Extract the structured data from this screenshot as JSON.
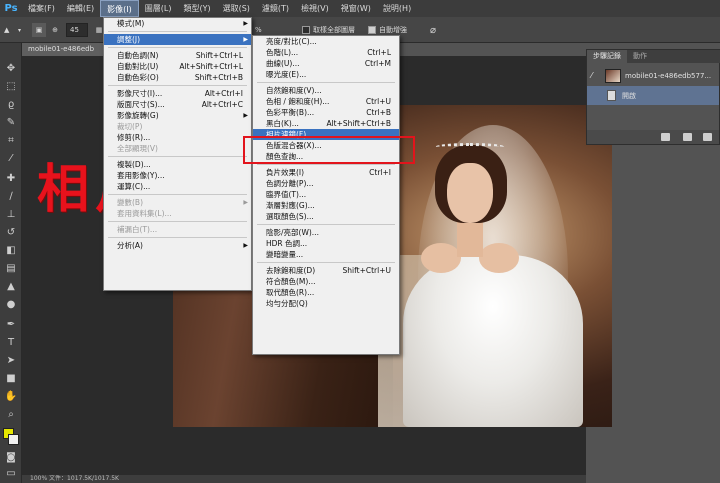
{
  "app": {
    "logo": "Ps"
  },
  "menubar": [
    "檔案(F)",
    "編輯(E)",
    "影像(I)",
    "圖層(L)",
    "類型(Y)",
    "選取(S)",
    "濾鏡(T)",
    "檢視(V)",
    "視窗(W)",
    "說明(H)"
  ],
  "options": {
    "size": "45",
    "percent": "%",
    "sample_all_layers": "取樣全部圖層",
    "auto_enhance": "自動增強"
  },
  "doc_tab": "mobile01-e486edb",
  "image_menu": [
    {
      "label": "模式(M)",
      "arrow": true
    },
    {
      "sep": true
    },
    {
      "label": "調整(J)",
      "arrow": true,
      "hl": true
    },
    {
      "sep": true
    },
    {
      "label": "自動色調(N)",
      "sc": "Shift+Ctrl+L"
    },
    {
      "label": "自動對比(U)",
      "sc": "Alt+Shift+Ctrl+L"
    },
    {
      "label": "自動色彩(O)",
      "sc": "Shift+Ctrl+B"
    },
    {
      "sep": true
    },
    {
      "label": "影像尺寸(I)...",
      "sc": "Alt+Ctrl+I"
    },
    {
      "label": "版面尺寸(S)...",
      "sc": "Alt+Ctrl+C"
    },
    {
      "label": "影像旋轉(G)",
      "arrow": true
    },
    {
      "label": "裁切(P)",
      "disabled": true
    },
    {
      "label": "修剪(R)..."
    },
    {
      "label": "全部顯現(V)",
      "disabled": true
    },
    {
      "sep": true
    },
    {
      "label": "複製(D)..."
    },
    {
      "label": "套用影像(Y)..."
    },
    {
      "label": "運算(C)..."
    },
    {
      "sep": true
    },
    {
      "label": "變數(B)",
      "arrow": true,
      "disabled": true
    },
    {
      "label": "套用資料集(L)...",
      "disabled": true
    },
    {
      "sep": true
    },
    {
      "label": "補漏白(T)...",
      "disabled": true
    },
    {
      "sep": true
    },
    {
      "label": "分析(A)",
      "arrow": true
    }
  ],
  "adjust_menu": [
    {
      "label": "亮度/對比(C)..."
    },
    {
      "label": "色階(L)...",
      "sc": "Ctrl+L"
    },
    {
      "label": "曲線(U)...",
      "sc": "Ctrl+M"
    },
    {
      "label": "曝光度(E)..."
    },
    {
      "sep": true
    },
    {
      "label": "自然飽和度(V)..."
    },
    {
      "label": "色相 / 飽和度(H)...",
      "sc": "Ctrl+U"
    },
    {
      "label": "色彩平衡(B)...",
      "sc": "Ctrl+B"
    },
    {
      "label": "黑白(K)...",
      "sc": "Alt+Shift+Ctrl+B"
    },
    {
      "label": "相片濾鏡(F)...",
      "hl": true
    },
    {
      "label": "色版混合器(X)..."
    },
    {
      "label": "顏色查詢..."
    },
    {
      "sep": true
    },
    {
      "label": "負片效果(I)",
      "sc": "Ctrl+I"
    },
    {
      "label": "色調分離(P)..."
    },
    {
      "label": "臨界值(T)..."
    },
    {
      "label": "漸層對應(G)..."
    },
    {
      "label": "選取顏色(S)..."
    },
    {
      "sep": true
    },
    {
      "label": "陰影/亮部(W)..."
    },
    {
      "label": "HDR 色調..."
    },
    {
      "label": "變暗變量..."
    },
    {
      "sep": true
    },
    {
      "label": "去除飽和度(D)",
      "sc": "Shift+Ctrl+U"
    },
    {
      "label": "符合顏色(M)..."
    },
    {
      "label": "取代顏色(R)..."
    },
    {
      "label": "均勻分配(Q)"
    }
  ],
  "overlay_title": "相片濾鏡",
  "panel": {
    "tabs": [
      "步驟記錄",
      "動作"
    ],
    "history_snapshot": "mobile01-e486edb577...",
    "history_step": "開啟"
  },
  "status": "100%    文件：1017.5K/1017.5K",
  "colors": {
    "foreground": "#e6e600",
    "background": "#f0f0f0",
    "highlight": "#3a72c0",
    "annotation_red": "#e2141c"
  }
}
